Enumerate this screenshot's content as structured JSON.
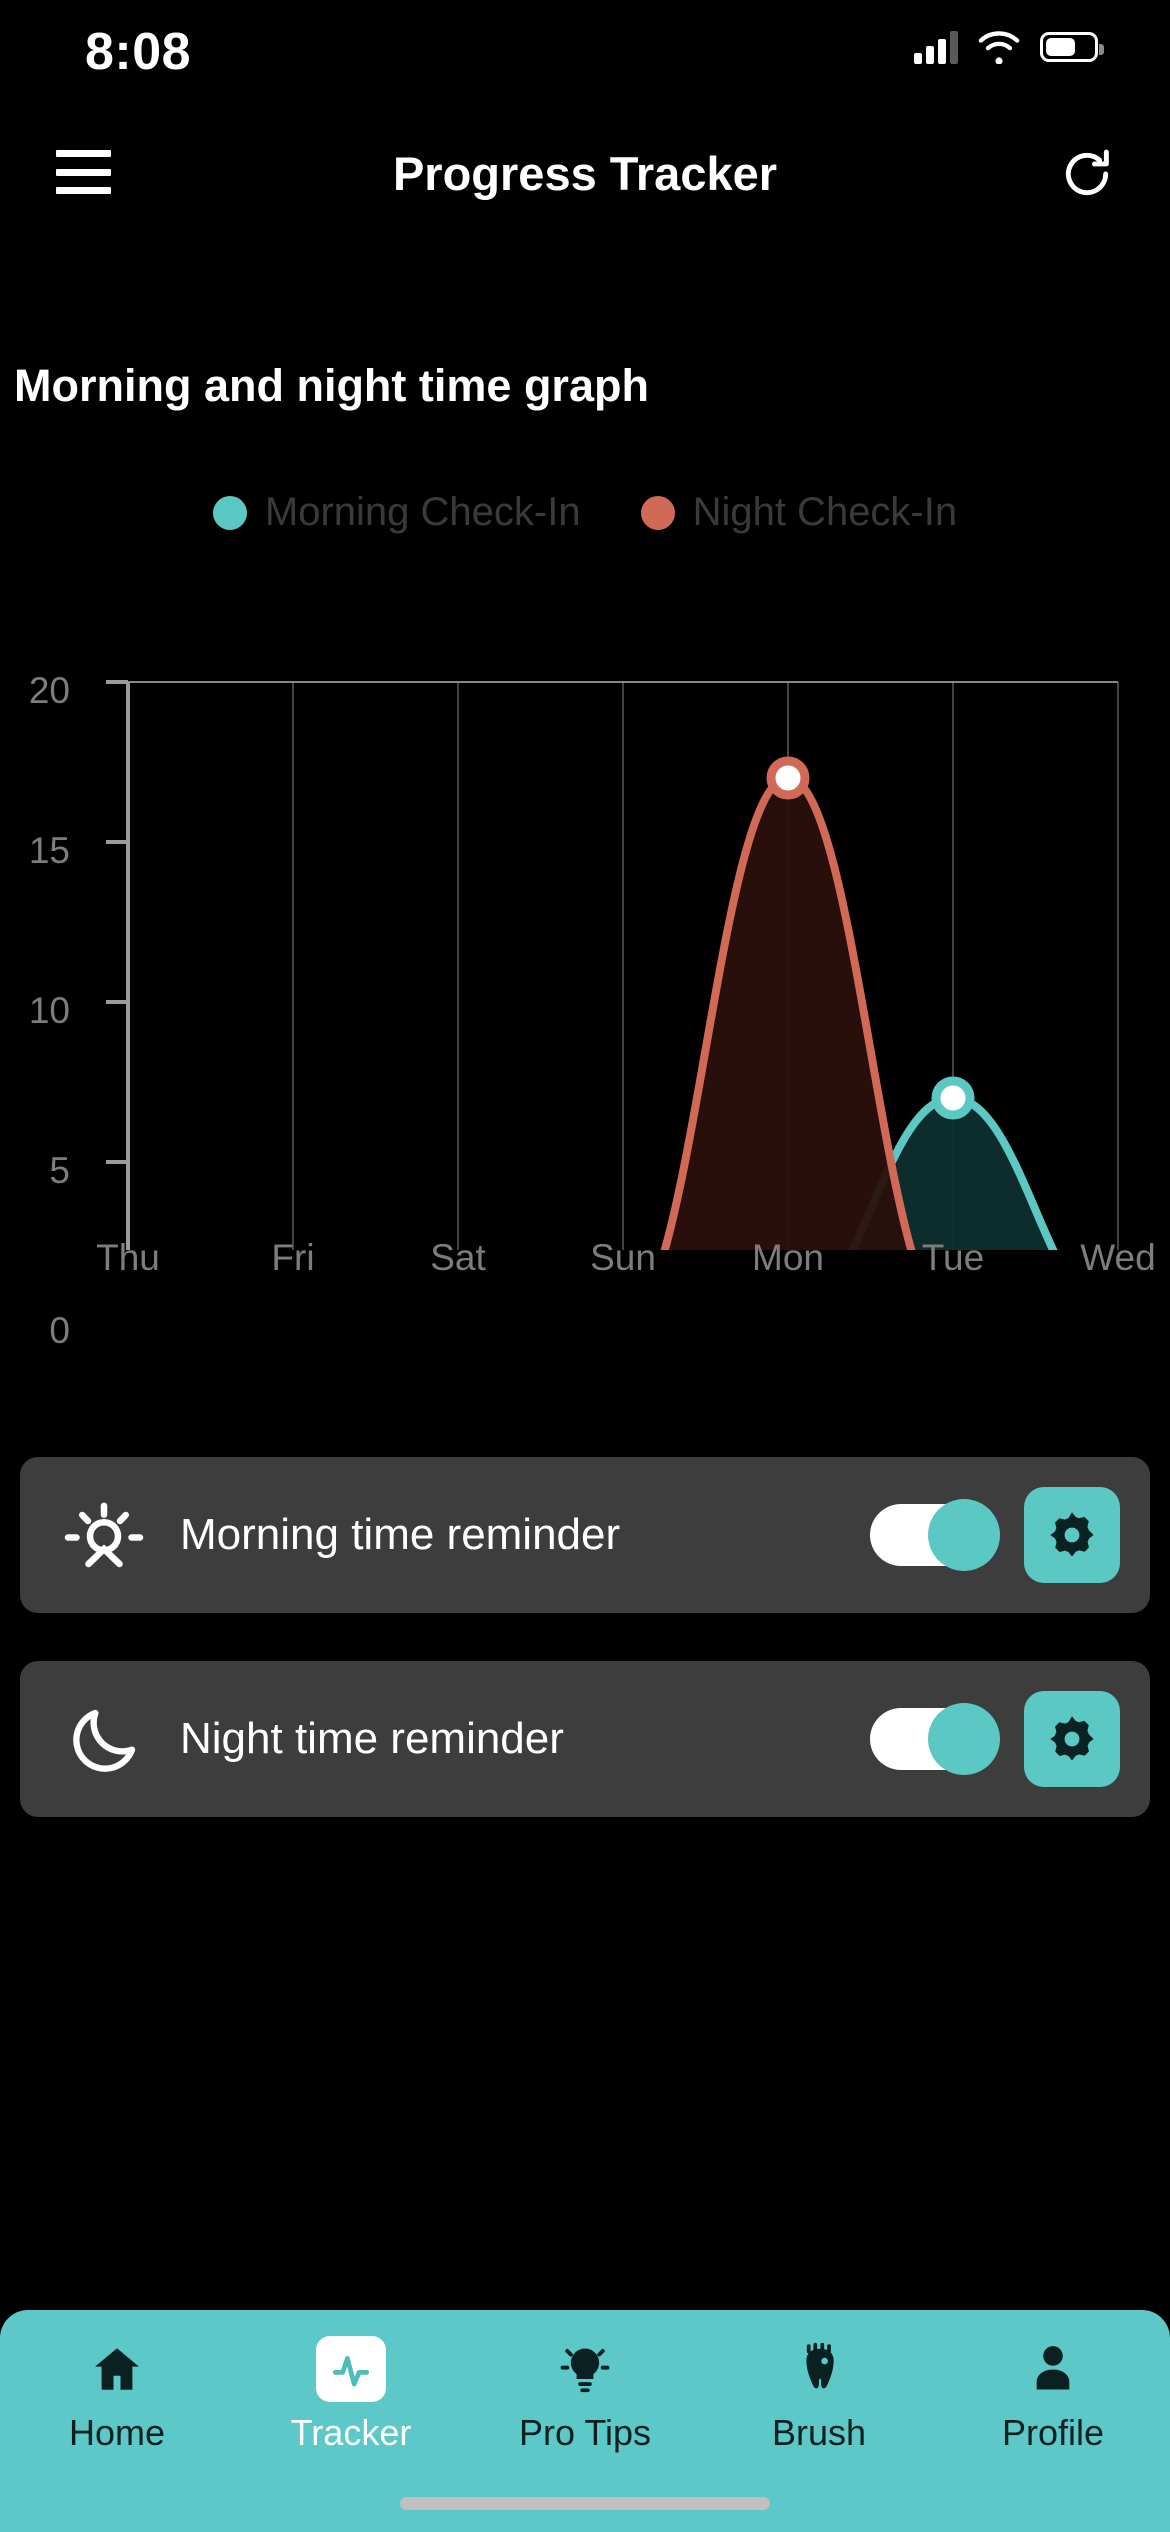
{
  "status_bar": {
    "time": "8:08",
    "signal_icon": "cellular-signal-icon",
    "wifi_icon": "wifi-icon",
    "battery_icon": "battery-icon"
  },
  "header": {
    "menu_icon": "hamburger-menu-icon",
    "title": "Progress Tracker",
    "refresh_icon": "refresh-icon"
  },
  "section": {
    "title": "Morning and night time graph"
  },
  "colors": {
    "morning": "#5bc8c4",
    "night": "#d06a57",
    "morning_fill": "#0e2e2e",
    "night_fill": "#2a100c",
    "card_bg": "#3d3d3d",
    "nav_bg": "#5cc9c8",
    "axis": "#7d7d7d",
    "legend_text": "#3a3a3a"
  },
  "chart_data": {
    "type": "area",
    "title": "Morning and night time graph",
    "xlabel": "",
    "ylabel": "",
    "categories": [
      "Thu",
      "Fri",
      "Sat",
      "Sun",
      "Mon",
      "Tue",
      "Wed"
    ],
    "ylim": [
      0,
      20
    ],
    "yticks": [
      0,
      5,
      10,
      15,
      20
    ],
    "ytick_labels": [
      "0",
      "5",
      "10",
      "15",
      "20"
    ],
    "grid": true,
    "legend_position": "top-center",
    "series": [
      {
        "name": "Morning Check-In",
        "color": "#5bc8c4",
        "values": [
          0,
          0,
          0,
          0,
          0,
          7,
          0
        ]
      },
      {
        "name": "Night Check-In",
        "color": "#d06a57",
        "values": [
          0,
          0,
          0,
          0,
          17,
          0,
          0
        ]
      }
    ]
  },
  "reminders": [
    {
      "icon": "sunrise-icon",
      "label": "Morning time reminder",
      "toggle_state": "on",
      "settings_icon": "gear-icon"
    },
    {
      "icon": "moon-icon",
      "label": "Night time reminder",
      "toggle_state": "on",
      "settings_icon": "gear-icon"
    }
  ],
  "bottom_nav": {
    "items": [
      {
        "label": "Home",
        "icon": "home-icon",
        "active": false
      },
      {
        "label": "Tracker",
        "icon": "pulse-icon",
        "active": true
      },
      {
        "label": "Pro Tips",
        "icon": "lightbulb-icon",
        "active": false
      },
      {
        "label": "Brush",
        "icon": "toothbrush-icon",
        "active": false
      },
      {
        "label": "Profile",
        "icon": "person-icon",
        "active": false
      }
    ]
  }
}
